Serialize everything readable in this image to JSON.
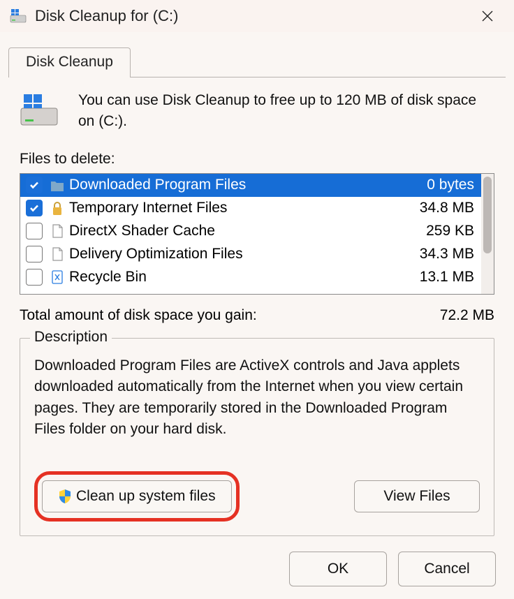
{
  "window": {
    "title": "Disk Cleanup for  (C:)"
  },
  "tab": {
    "label": "Disk Cleanup"
  },
  "intro": {
    "text": "You can use Disk Cleanup to free up to 120 MB of disk space on  (C:)."
  },
  "files_label": "Files to delete:",
  "rows": [
    {
      "label": "Downloaded Program Files",
      "size": "0 bytes",
      "checked": true,
      "selected": true,
      "icon": "folder-icon"
    },
    {
      "label": "Temporary Internet Files",
      "size": "34.8 MB",
      "checked": true,
      "selected": false,
      "icon": "lock-icon"
    },
    {
      "label": "DirectX Shader Cache",
      "size": "259 KB",
      "checked": false,
      "selected": false,
      "icon": "file-icon"
    },
    {
      "label": "Delivery Optimization Files",
      "size": "34.3 MB",
      "checked": false,
      "selected": false,
      "icon": "file-icon"
    },
    {
      "label": "Recycle Bin",
      "size": "13.1 MB",
      "checked": false,
      "selected": false,
      "icon": "recycle-icon"
    }
  ],
  "total": {
    "label": "Total amount of disk space you gain:",
    "value": "72.2 MB"
  },
  "description": {
    "legend": "Description",
    "text": "Downloaded Program Files are ActiveX controls and Java applets downloaded automatically from the Internet when you view certain pages. They are temporarily stored in the Downloaded Program Files folder on your hard disk."
  },
  "buttons": {
    "cleanup_system": "Clean up system files",
    "view_files": "View Files",
    "ok": "OK",
    "cancel": "Cancel"
  }
}
